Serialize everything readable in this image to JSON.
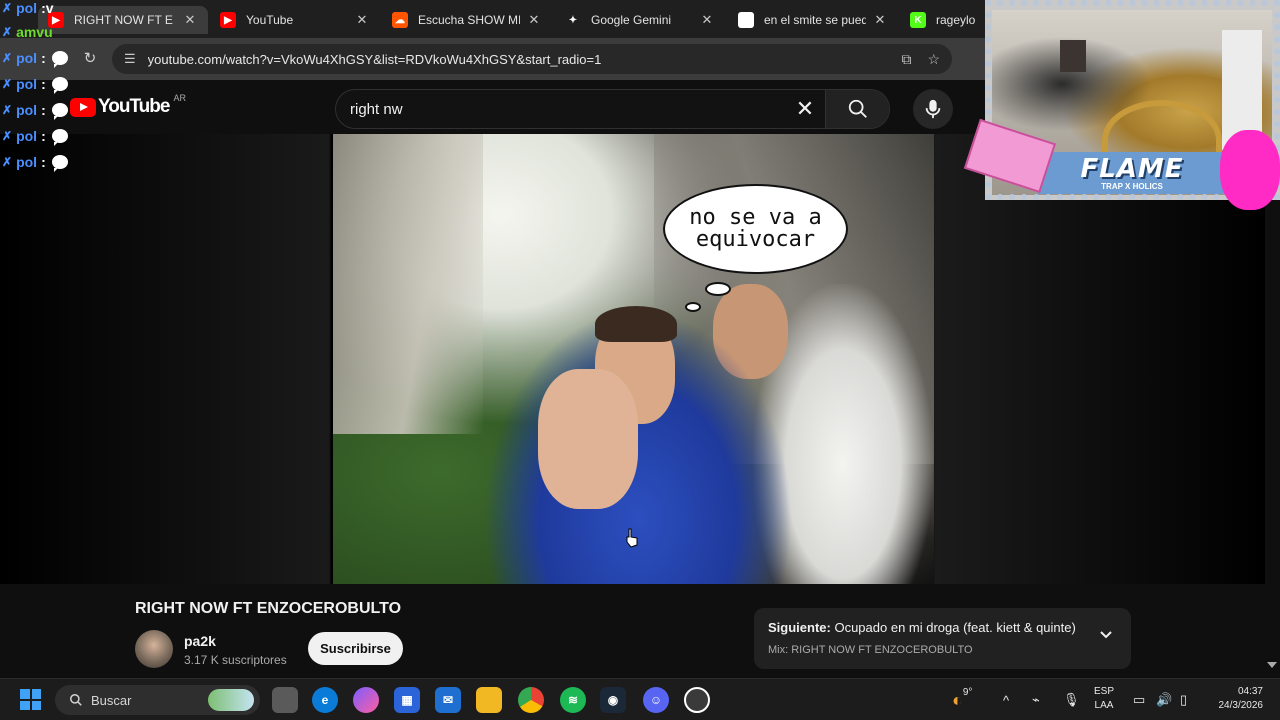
{
  "browser": {
    "tabs": [
      {
        "title": "RIGHT NOW FT E",
        "icon": "youtube-icon",
        "active": true
      },
      {
        "title": "YouTube",
        "icon": "youtube-icon",
        "active": false
      },
      {
        "title": "Escucha SHOW MIXT",
        "icon": "soundcloud-icon",
        "active": false
      },
      {
        "title": "Google Gemini",
        "icon": "gemini-icon",
        "active": false
      },
      {
        "title": "en el smite se puede",
        "icon": "google-icon",
        "active": false
      },
      {
        "title": "rageylo Str",
        "icon": "kick-icon",
        "active": false
      }
    ],
    "url": "youtube.com/watch?v=VkoWu4XhGSY&list=RDVkoWu4XhGSY&start_radio=1"
  },
  "chat_overlay": {
    "lines": [
      {
        "user": "pol",
        "message": ":v"
      },
      {
        "user": "amvu",
        "message": ""
      },
      {
        "user": "pol",
        "message": ":"
      },
      {
        "user": "pol",
        "message": ":"
      },
      {
        "user": "pol",
        "message": ":"
      },
      {
        "user": "pol",
        "message": ":"
      },
      {
        "user": "pol",
        "message": ":"
      }
    ]
  },
  "youtube": {
    "logo_text": "YouTube",
    "country_code": "AR",
    "search_query": "right nw"
  },
  "video": {
    "speech_bubble_line1": "no se va a",
    "speech_bubble_line2": "equivocar",
    "title": "RIGHT NOW FT ENZOCEROBULTO",
    "channel_name": "pa2k",
    "subscribers": "3.17 K suscriptores",
    "subscribe_label": "Suscribirse"
  },
  "up_next": {
    "label": "Siguiente:",
    "title": "Ocupado en mi droga (feat. kiett & quinte)",
    "mix": "Mix: RIGHT NOW FT ENZOCEROBULTO"
  },
  "webcam_overlay": {
    "banner_title": "FLAME",
    "banner_subtitle": "TRAP X HOLICS"
  },
  "taskbar": {
    "search_placeholder": "Buscar",
    "weather_temp": "9°",
    "language_line1": "ESP",
    "language_line2": "LAA",
    "time": "04:37",
    "date": "24/3/2026"
  },
  "colors": {
    "youtube_red": "#ff0000",
    "chat_user_blue": "#4a8fff",
    "chat_user_green": "#6fdc2e",
    "windows_blue": "#3fa2f7"
  }
}
